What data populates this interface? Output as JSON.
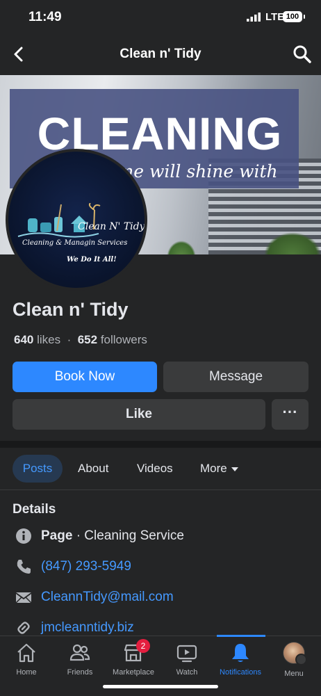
{
  "status": {
    "time": "11:49",
    "network": "LTE",
    "battery": "100"
  },
  "nav": {
    "title": "Clean n' Tidy",
    "back_icon": "chevron-left-icon",
    "search_icon": "search-icon"
  },
  "cover": {
    "headline": "CLEANING",
    "tagline": "Your home will shine with us!"
  },
  "logo": {
    "title": "Clean N' Tidy",
    "subtitle": "Cleaning & Managin Services",
    "motto": "We Do It All!"
  },
  "page": {
    "name": "Clean n' Tidy",
    "likes_count": "640",
    "likes_label": "likes",
    "dot": "·",
    "followers_count": "652",
    "followers_label": "followers"
  },
  "actions": {
    "book": "Book Now",
    "message": "Message",
    "like": "Like",
    "more": "···"
  },
  "tabs": {
    "posts": "Posts",
    "about": "About",
    "videos": "Videos",
    "more": "More"
  },
  "details": {
    "title": "Details",
    "category_prefix": "Page",
    "category": " · Cleaning Service",
    "phone": "(847) 293-5949",
    "email": "CleannTidy@mail.com",
    "website": "jmcleanntidy.biz"
  },
  "bottom_nav": {
    "home": "Home",
    "friends": "Friends",
    "marketplace": "Marketplace",
    "marketplace_badge": "2",
    "watch": "Watch",
    "notifications": "Notifications",
    "menu": "Menu"
  },
  "colors": {
    "accent": "#2d88ff",
    "background": "#242526",
    "badge": "#e41e3f"
  }
}
